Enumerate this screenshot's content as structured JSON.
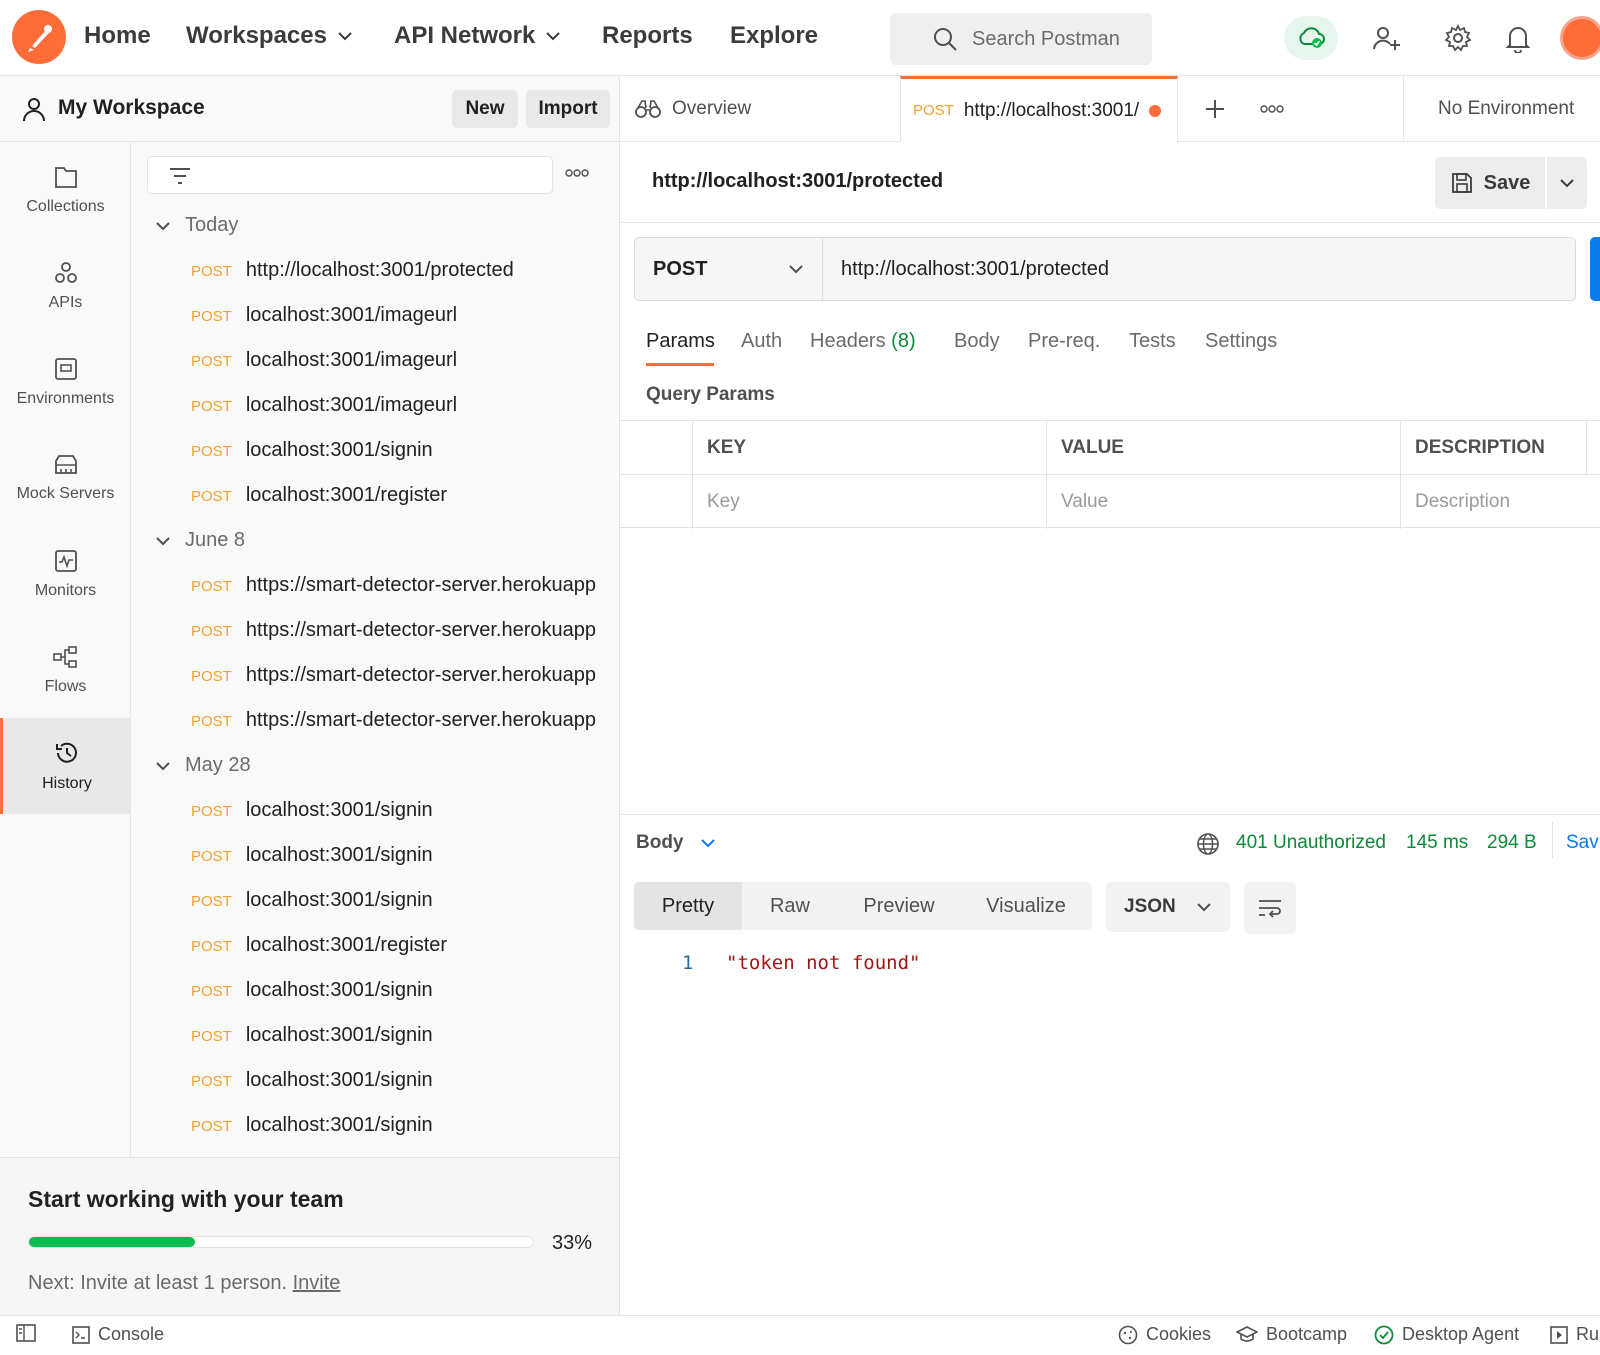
{
  "topbar": {
    "nav": [
      "Home",
      "Workspaces",
      "API Network",
      "Reports",
      "Explore"
    ],
    "search_placeholder": "Search Postman"
  },
  "workspace": {
    "title": "My Workspace",
    "new_label": "New",
    "import_label": "Import"
  },
  "rail": [
    {
      "label": "Collections",
      "icon": "collections-icon"
    },
    {
      "label": "APIs",
      "icon": "apis-icon"
    },
    {
      "label": "Environments",
      "icon": "environments-icon"
    },
    {
      "label": "Mock Servers",
      "icon": "mock-servers-icon"
    },
    {
      "label": "Monitors",
      "icon": "monitors-icon"
    },
    {
      "label": "Flows",
      "icon": "flows-icon"
    },
    {
      "label": "History",
      "icon": "history-icon",
      "active": true
    }
  ],
  "history": {
    "groups": [
      {
        "label": "Today",
        "items": [
          {
            "method": "POST",
            "url": "http://localhost:3001/protected"
          },
          {
            "method": "POST",
            "url": "localhost:3001/imageurl"
          },
          {
            "method": "POST",
            "url": "localhost:3001/imageurl"
          },
          {
            "method": "POST",
            "url": "localhost:3001/imageurl"
          },
          {
            "method": "POST",
            "url": "localhost:3001/signin"
          },
          {
            "method": "POST",
            "url": "localhost:3001/register"
          }
        ]
      },
      {
        "label": "June 8",
        "items": [
          {
            "method": "POST",
            "url": "https://smart-detector-server.herokuapp"
          },
          {
            "method": "POST",
            "url": "https://smart-detector-server.herokuapp"
          },
          {
            "method": "POST",
            "url": "https://smart-detector-server.herokuapp"
          },
          {
            "method": "POST",
            "url": "https://smart-detector-server.herokuapp"
          }
        ]
      },
      {
        "label": "May 28",
        "items": [
          {
            "method": "POST",
            "url": "localhost:3001/signin"
          },
          {
            "method": "POST",
            "url": "localhost:3001/signin"
          },
          {
            "method": "POST",
            "url": "localhost:3001/signin"
          },
          {
            "method": "POST",
            "url": "localhost:3001/register"
          },
          {
            "method": "POST",
            "url": "localhost:3001/signin"
          },
          {
            "method": "POST",
            "url": "localhost:3001/signin"
          },
          {
            "method": "POST",
            "url": "localhost:3001/signin"
          },
          {
            "method": "POST",
            "url": "localhost:3001/signin"
          }
        ]
      }
    ]
  },
  "team_card": {
    "title": "Start working with your team",
    "progress_percent": 33,
    "progress_label": "33%",
    "next_text": "Next: Invite at least 1 person.",
    "invite_label": "Invite"
  },
  "tabs": {
    "overview_label": "Overview",
    "active_method": "POST",
    "active_url": "http://localhost:3001/",
    "environment": "No Environment"
  },
  "request": {
    "title": "http://localhost:3001/protected",
    "save_label": "Save",
    "method": "POST",
    "url": "http://localhost:3001/protected",
    "tabs": [
      "Params",
      "Auth",
      "Headers",
      "Body",
      "Pre-req.",
      "Tests",
      "Settings"
    ],
    "headers_count": "(8)",
    "query_params_label": "Query Params",
    "table_headers": [
      "KEY",
      "VALUE",
      "DESCRIPTION"
    ],
    "placeholders": [
      "Key",
      "Value",
      "Description"
    ]
  },
  "response": {
    "body_label": "Body",
    "status": "401 Unauthorized",
    "time": "145 ms",
    "size": "294 B",
    "save_partial": "Sav",
    "views": [
      "Pretty",
      "Raw",
      "Preview",
      "Visualize"
    ],
    "format": "JSON",
    "line_number": "1",
    "line_content": "\"token not found\""
  },
  "statusbar": {
    "console": "Console",
    "cookies": "Cookies",
    "bootcamp": "Bootcamp",
    "desktop_agent": "Desktop Agent",
    "runner_partial": "Ru"
  },
  "colors": {
    "accent": "#ff6c37",
    "post": "#f2a12f",
    "success": "#0c8a3a",
    "send": "#097bed",
    "progress": "#0cbb52"
  }
}
